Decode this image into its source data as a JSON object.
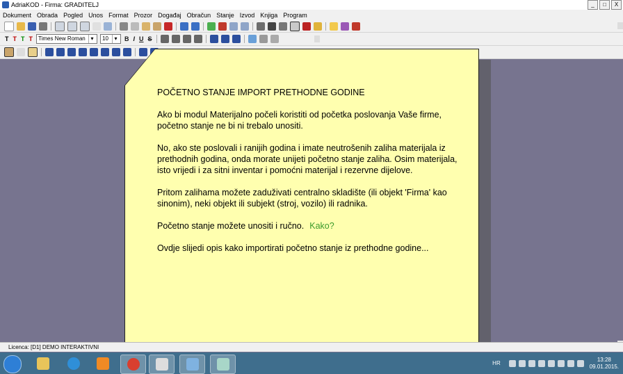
{
  "window": {
    "title": "AdriaKOD - Firma: GRADITELJ",
    "min_label": "_",
    "max_label": "□",
    "close_label": "X"
  },
  "menu": [
    "Dokument",
    "Obrada",
    "Pogled",
    "Unos",
    "Format",
    "Prozor",
    "Događaj",
    "Obračun",
    "Stanje",
    "Izvod",
    "Knjiga",
    "Program"
  ],
  "format_toolbar": {
    "font_name": "Times New Roman",
    "font_size": "10",
    "bold": "B",
    "italic": "I",
    "underline": "U",
    "strike": "S"
  },
  "note": {
    "heading": "POČETNO STANJE IMPORT PRETHODNE GODINE",
    "p1": "Ako bi modul Materijalno počeli koristiti od početka poslovanja Vaše firme, početno stanje ne bi ni trebalo unositi.",
    "p2": "No, ako ste poslovali i ranijih godina i imate neutrošenih zaliha materijala iz prethodnih godina, onda morate unijeti početno stanje zaliha. Osim materijala, isto vrijedi i za sitni inventar i pomoćni materijal i rezervne dijelove.",
    "p3": "Pritom zalihama možete zaduživati centralno skladište (ili objekt 'Firma' kao sinonim), neki objekt ili subjekt (stroj, vozilo) ili radnika.",
    "p4": "Početno stanje možete unositi i ručno.",
    "link": "Kako?",
    "p5": "Ovdje slijedi opis kako importirati početno stanje iz prethodne godine..."
  },
  "statusbar": {
    "licence": "Licenca:  [D1] DEMO INTERAKTIVNI"
  },
  "taskbar": {
    "language": "HR",
    "time": "13:28",
    "date": "09.01.2015."
  },
  "colors": {
    "desktop_bg": "#77748f",
    "note_bg": "#ffffaf",
    "link": "#3b9a2b",
    "taskbar": "#3f6e8d"
  }
}
